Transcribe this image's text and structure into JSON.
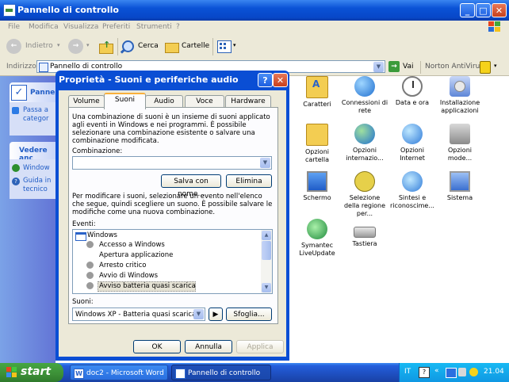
{
  "window": {
    "title": "Pannello di controllo"
  },
  "menu": [
    "File",
    "Modifica",
    "Visualizza",
    "Preferiti",
    "Strumenti",
    "?"
  ],
  "toolbar": {
    "back": "Indietro",
    "search": "Cerca",
    "folders": "Cartelle"
  },
  "address": {
    "label": "Indirizzo",
    "value": "Pannello di controllo",
    "go": "Vai",
    "norton": "Norton AntiVirus"
  },
  "left_pane": {
    "panel_title": "Pannell",
    "switch_text": "Passa a",
    "categ_text": "categor",
    "see_also": "Vedere anc",
    "links": [
      "Window",
      "Guida in",
      "tecnico"
    ]
  },
  "items": [
    {
      "label": "Caratteri"
    },
    {
      "label": "Connessioni di rete"
    },
    {
      "label": "Data e ora"
    },
    {
      "label": "Installazione applicazioni"
    },
    {
      "label": "Opzioni cartella"
    },
    {
      "label": "Opzioni internazio..."
    },
    {
      "label": "Opzioni Internet"
    },
    {
      "label": "Opzioni mode..."
    },
    {
      "label": "Schermo"
    },
    {
      "label": "Selezione della regione per..."
    },
    {
      "label": "Sintesi e riconoscime..."
    },
    {
      "label": "Sistema"
    },
    {
      "label": "Symantec LiveUpdate"
    },
    {
      "label": "Tastiera"
    }
  ],
  "dialog": {
    "title": "Proprietà - Suoni e periferiche audio",
    "tabs": [
      "Volume",
      "Suoni",
      "Audio",
      "Voce",
      "Hardware"
    ],
    "intro": "Una combinazione di suoni è un insieme di suoni applicato agli eventi in Windows e nei programmi. È possibile selezionare una combinazione esistente o salvare una combinazione modificata.",
    "combination_label": "Combinazione:",
    "combination_value": "",
    "save_as": "Salva con nome...",
    "delete": "Elimina",
    "instructions": "Per modificare i suoni, selezionare un evento nell'elenco che segue, quindi scegliere un suono. È possibile salvare le modifiche come una nuova combinazione.",
    "events_label": "Eventi:",
    "events": [
      "Windows",
      "Accesso a Windows",
      "Apertura applicazione",
      "Arresto critico",
      "Avvio di Windows",
      "Avviso batteria quasi scarica"
    ],
    "sounds_label": "Suoni:",
    "sound_value": "Windows XP - Batteria quasi scarica",
    "browse": "Sfoglia...",
    "ok": "OK",
    "cancel": "Annulla",
    "apply": "Applica"
  },
  "taskbar": {
    "start": "start",
    "tasks": [
      "doc2 - Microsoft Word",
      "Pannello di controllo"
    ],
    "lang": "IT",
    "clock": "21.04"
  }
}
